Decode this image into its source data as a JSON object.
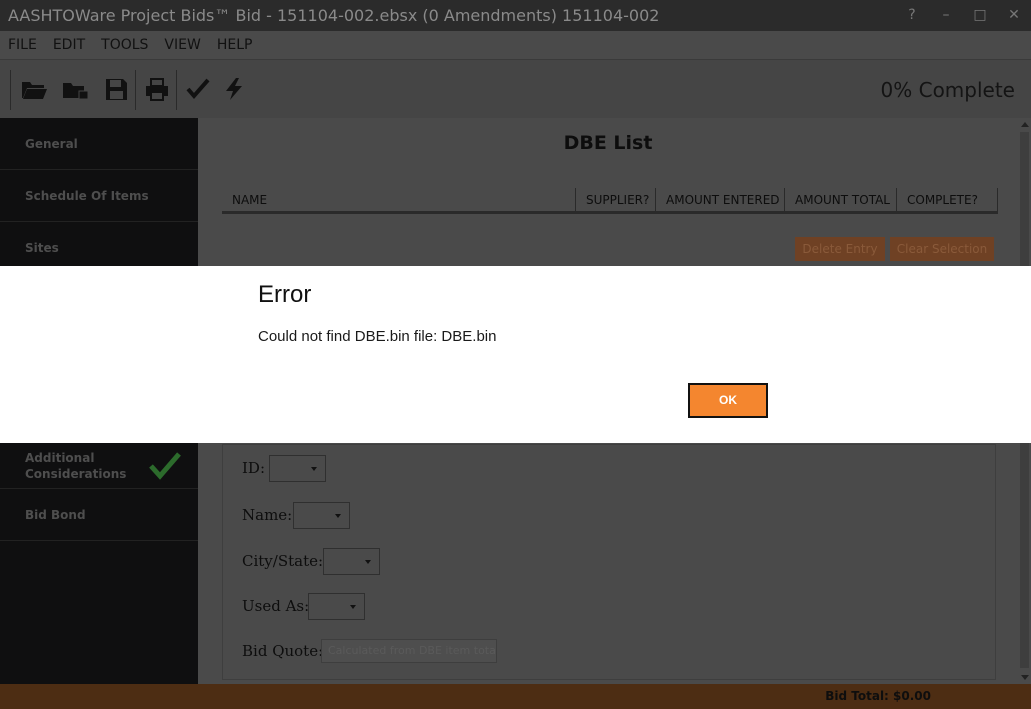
{
  "window": {
    "title": "AASHTOWare Project Bids™ Bid - 151104-002.ebsx (0 Amendments) 151104-002",
    "controls": [
      "?",
      "–",
      "□",
      "✕"
    ]
  },
  "menu": [
    "FILE",
    "EDIT",
    "TOOLS",
    "VIEW",
    "HELP"
  ],
  "toolbar": {
    "icons": [
      "open-folder-icon",
      "open-network-icon",
      "save-icon",
      "print-icon",
      "check-icon",
      "lightning-icon"
    ],
    "progress": "0% Complete"
  },
  "sidebar": {
    "items": [
      {
        "label": "General",
        "checked": false
      },
      {
        "label": "Schedule Of Items",
        "checked": false
      },
      {
        "label": "Sites",
        "checked": false
      },
      {
        "label": "Additional Considerations",
        "checked": true
      },
      {
        "label": "Bid Bond",
        "checked": false
      }
    ]
  },
  "main": {
    "title": "DBE List",
    "columns": [
      "NAME",
      "SUPPLIER?",
      "AMOUNT ENTERED",
      "AMOUNT TOTAL",
      "COMPLETE?"
    ],
    "buttons": {
      "delete": "Delete Entry",
      "clear": "Clear Selection"
    },
    "form": {
      "id_label": "ID:",
      "name_label": "Name:",
      "city_label": "City/State:",
      "used_as_label": "Used As:",
      "bid_quote_label": "Bid Quote:",
      "bid_quote_placeholder": "Calculated from DBE item tota"
    }
  },
  "footer": {
    "bid_total": "Bid Total: $0.00"
  },
  "dialog": {
    "title": "Error",
    "message": "Could not find DBE.bin file: DBE.bin",
    "ok_label": "OK"
  },
  "colors": {
    "accent": "#f4862f",
    "check": "#3a8f3a",
    "footer": "#4d2d13"
  }
}
